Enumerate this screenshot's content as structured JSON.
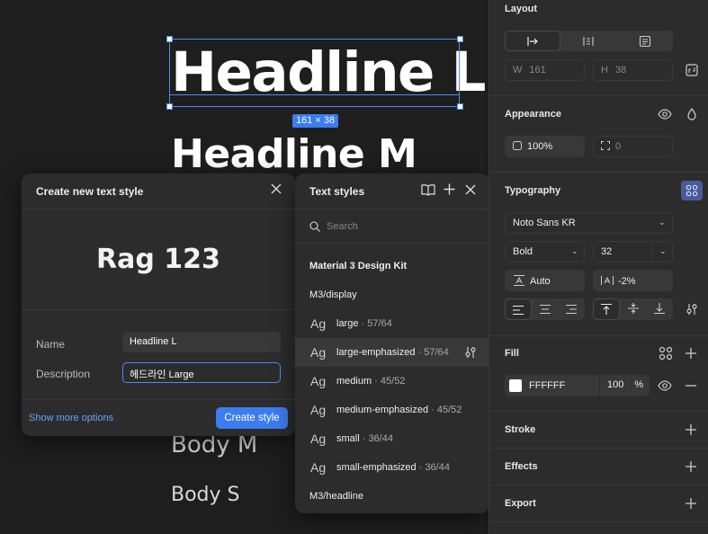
{
  "canvas": {
    "headline_l": "Headline L",
    "headline_m": "Headline M",
    "body_m": "Body M",
    "body_s": "Body S",
    "selection_size": "161 × 38"
  },
  "create_dialog": {
    "title": "Create new text style",
    "preview": "Rag 123",
    "name_label": "Name",
    "name_value": "Headline L",
    "description_label": "Description",
    "description_value": "헤드라인 Large",
    "more_options": "Show more options",
    "create_button": "Create style"
  },
  "text_styles": {
    "title": "Text styles",
    "search_placeholder": "Search",
    "kit": "Material 3 Design Kit",
    "group_display": "M3/display",
    "group_headline": "M3/headline",
    "items": [
      {
        "ag": "Ag",
        "name": "large",
        "meta": " · 57/64"
      },
      {
        "ag": "Ag",
        "name": "large-emphasized",
        "meta": " · 57/64"
      },
      {
        "ag": "Ag",
        "name": "medium",
        "meta": " · 45/52"
      },
      {
        "ag": "Ag",
        "name": "medium-emphasized",
        "meta": " · 45/52"
      },
      {
        "ag": "Ag",
        "name": "small",
        "meta": " · 36/44"
      },
      {
        "ag": "Ag",
        "name": "small-emphasized",
        "meta": " · 36/44"
      }
    ]
  },
  "sidebar": {
    "layout": {
      "title": "Layout",
      "w_label": "W",
      "w_value": "161",
      "h_label": "H",
      "h_value": "38"
    },
    "appearance": {
      "title": "Appearance",
      "opacity": "100%",
      "radius": "0"
    },
    "typography": {
      "title": "Typography",
      "font_family": "Noto Sans KR",
      "font_weight": "Bold",
      "font_size": "32",
      "line_height": "Auto",
      "letter_spacing": "-2%"
    },
    "fill": {
      "title": "Fill",
      "color_hex": "FFFFFF",
      "opacity": "100",
      "unit": "%"
    },
    "stroke": {
      "title": "Stroke"
    },
    "effects": {
      "title": "Effects"
    },
    "export": {
      "title": "Export"
    }
  },
  "colors": {
    "accent": "#3b7cf0",
    "panel": "#2c2c2c",
    "canvas": "#1e1e1e",
    "fill_swatch": "#FFFFFF"
  }
}
